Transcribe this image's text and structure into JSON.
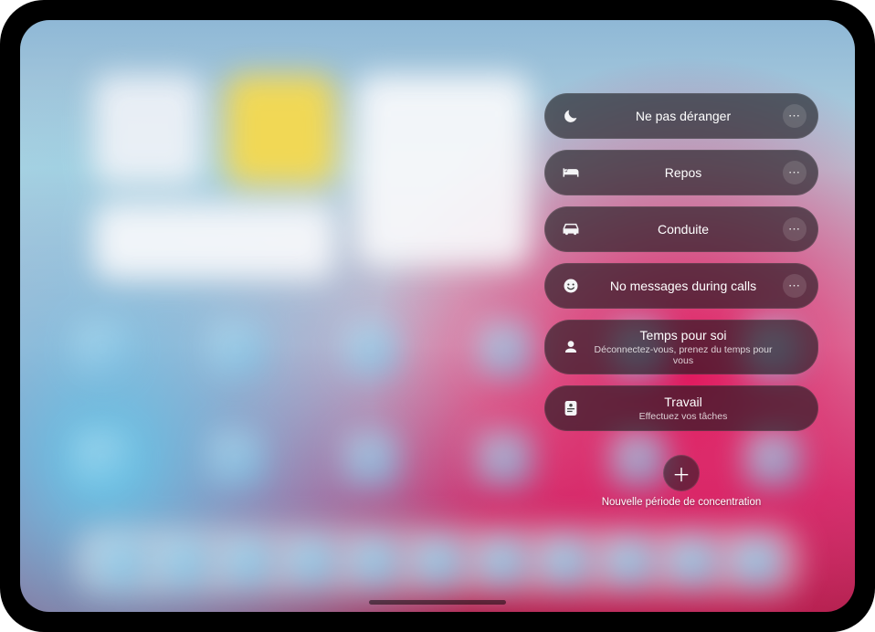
{
  "focus": {
    "items": [
      {
        "icon": "moon",
        "label": "Ne pas déranger",
        "subtitle": "",
        "has_more": true
      },
      {
        "icon": "bed",
        "label": "Repos",
        "subtitle": "",
        "has_more": true
      },
      {
        "icon": "car",
        "label": "Conduite",
        "subtitle": "",
        "has_more": true
      },
      {
        "icon": "smile",
        "label": "No messages during calls",
        "subtitle": "",
        "has_more": true
      },
      {
        "icon": "person",
        "label": "Temps pour soi",
        "subtitle": "Déconnectez-vous, prenez du temps pour vous",
        "has_more": false
      },
      {
        "icon": "badge",
        "label": "Travail",
        "subtitle": "Effectuez vos tâches",
        "has_more": false
      }
    ],
    "add_label": "Nouvelle période de concentration"
  }
}
